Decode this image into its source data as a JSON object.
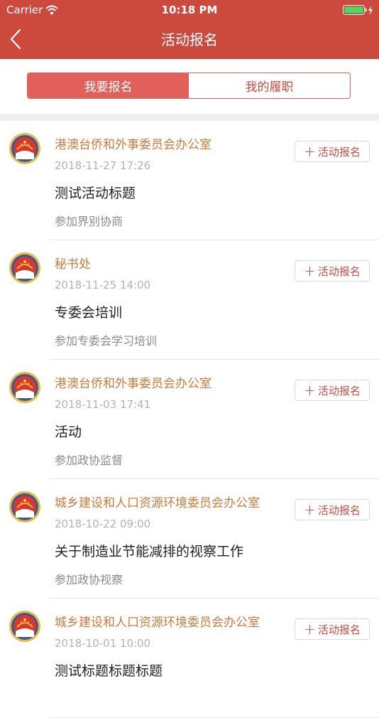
{
  "status_bar": {
    "carrier": "Carrier",
    "time": "10:18 PM"
  },
  "nav": {
    "title": "活动报名"
  },
  "segments": [
    {
      "label": "我要报名",
      "active": true
    },
    {
      "label": "我的履职",
      "active": false
    }
  ],
  "colors": {
    "header": "#cc4a3d",
    "accent": "#e2605a",
    "org_name": "#cf7a3c",
    "date": "#b3b3b3"
  },
  "items": [
    {
      "org": "港澳台侨和外事委员会办公室",
      "date": "2018-11-27 17:26",
      "title": "测试活动标题",
      "subtitle": "参加界别协商",
      "button": "活动报名"
    },
    {
      "org": "秘书处",
      "date": "2018-11-25 14:00",
      "title": "专委会培训",
      "subtitle": "参加专委会学习培训",
      "button": "活动报名"
    },
    {
      "org": "港澳台侨和外事委员会办公室",
      "date": "2018-11-03 17:41",
      "title": "活动",
      "subtitle": "参加政协监督",
      "button": "活动报名"
    },
    {
      "org": "城乡建设和人口资源环境委员会办公室",
      "date": "2018-10-22 09:00",
      "title": "关于制造业节能减排的视察工作",
      "subtitle": "参加政协视察",
      "button": "活动报名"
    },
    {
      "org": "城乡建设和人口资源环境委员会办公室",
      "date": "2018-10-01 10:00",
      "title": "测试标题标题标题",
      "subtitle": "",
      "button": "活动报名"
    }
  ]
}
